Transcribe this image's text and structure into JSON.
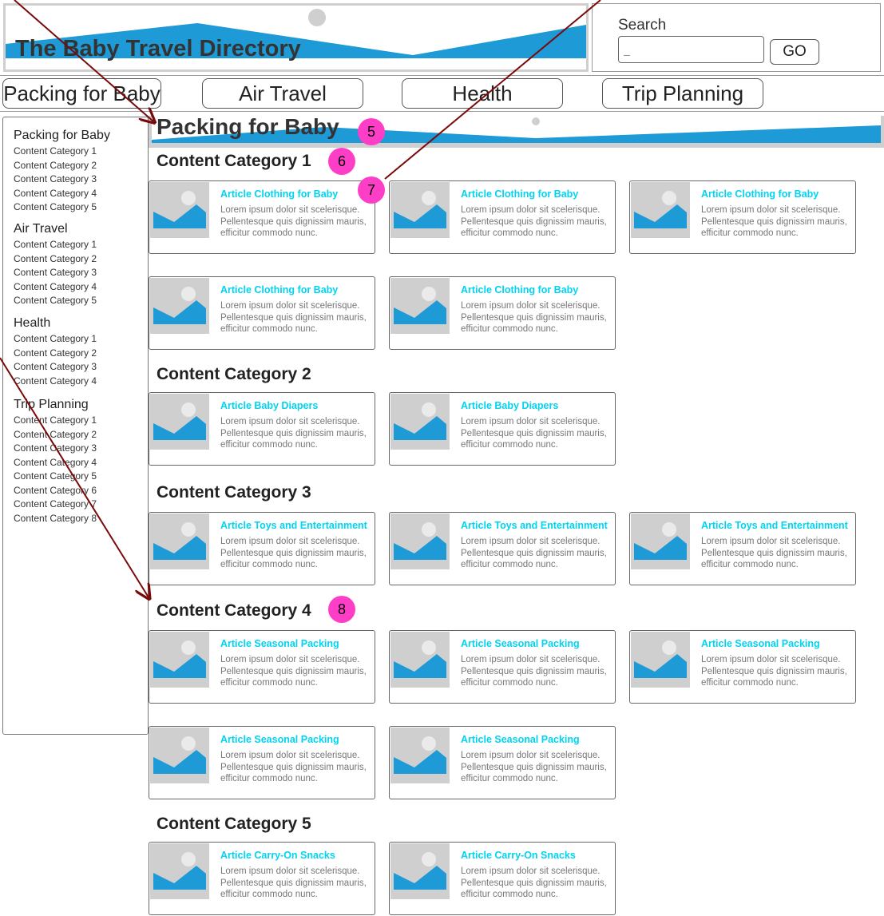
{
  "header": {
    "site_title": "The Baby Travel Directory",
    "brand_color": "#1e9ad6"
  },
  "search": {
    "label": "Search",
    "value": "_",
    "go_label": "GO"
  },
  "nav": {
    "tabs": [
      "Packing for Baby",
      "Air Travel",
      "Health",
      "Trip Planning"
    ]
  },
  "sidebar": {
    "groups": [
      {
        "heading": "Packing for Baby",
        "items": [
          "Content Category 1",
          "Content Category 2",
          "Content Category 3",
          "Content Category 4",
          "Content Category 5"
        ]
      },
      {
        "heading": "Air Travel",
        "items": [
          "Content Category 1",
          "Content Category 2",
          "Content Category 3",
          "Content Category 4",
          "Content Category 5"
        ]
      },
      {
        "heading": "Health",
        "items": [
          "Content Category 1",
          "Content Category 2",
          "Content Category 3",
          "Content Category 4"
        ]
      },
      {
        "heading": "Trip Planning",
        "items": [
          "Content Category 1",
          "Content Category 2",
          "Content Category 3",
          "Content Category 4",
          "Content Category 5",
          "Content Category 6",
          "Content Category 7",
          "Content Category 8"
        ]
      }
    ]
  },
  "main": {
    "page_heading": "Packing for Baby",
    "card_body": "Lorem ipsum dolor sit scelerisque. Pellentesque quis dignissim mauris, efficitur commodo nunc.",
    "categories": [
      {
        "title": "Content Category 1",
        "article_title": "Article Clothing for Baby",
        "count": 5
      },
      {
        "title": "Content Category 2",
        "article_title": "Article Baby Diapers",
        "count": 2
      },
      {
        "title": "Content Category 3",
        "article_title": "Article Toys and Entertainment",
        "count": 3
      },
      {
        "title": "Content Category 4",
        "article_title": "Article Seasonal Packing",
        "count": 5
      },
      {
        "title": "Content Category 5",
        "article_title": "Article Carry-On Snacks",
        "count": 2
      }
    ]
  },
  "annotations": {
    "badges": [
      "5",
      "6",
      "7",
      "8"
    ],
    "badge_color": "#ff3ec8",
    "arrow_color": "#7a0a0a"
  }
}
